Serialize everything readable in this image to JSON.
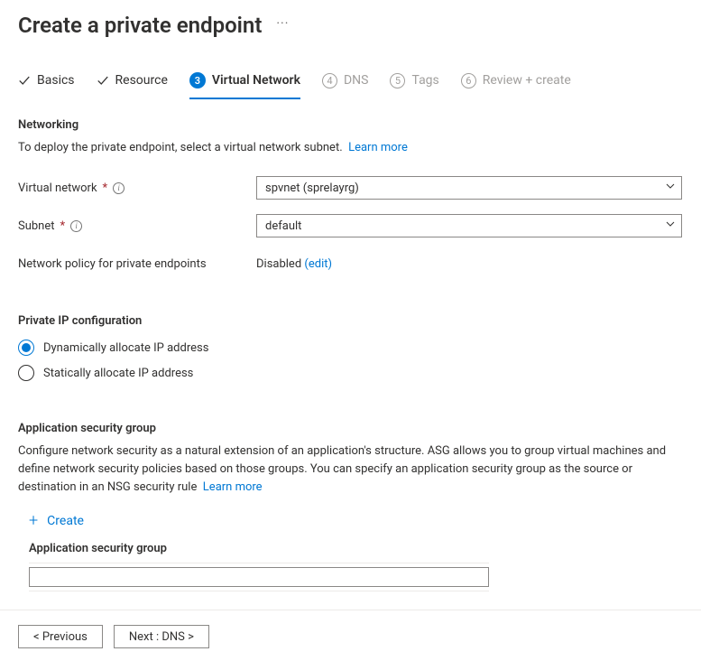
{
  "header": {
    "title": "Create a private endpoint"
  },
  "steps": [
    {
      "label": "Basics",
      "state": "done"
    },
    {
      "label": "Resource",
      "state": "done"
    },
    {
      "label": "Virtual Network",
      "state": "current",
      "num": "3"
    },
    {
      "label": "DNS",
      "state": "future",
      "num": "4"
    },
    {
      "label": "Tags",
      "state": "future",
      "num": "5"
    },
    {
      "label": "Review + create",
      "state": "future",
      "num": "6"
    }
  ],
  "networking": {
    "section_title": "Networking",
    "description": "To deploy the private endpoint, select a virtual network subnet.",
    "learn_more": "Learn more",
    "virtual_network_label": "Virtual network",
    "virtual_network_value": "spvnet (sprelayrg)",
    "subnet_label": "Subnet",
    "subnet_value": "default",
    "policy_label": "Network policy for private endpoints",
    "policy_value": "Disabled",
    "policy_edit": "(edit)"
  },
  "ipconfig": {
    "section_title": "Private IP configuration",
    "options": {
      "dynamic": "Dynamically allocate IP address",
      "static": "Statically allocate IP address"
    }
  },
  "asg": {
    "section_title": "Application security group",
    "description": "Configure network security as a natural extension of an application's structure. ASG allows you to group virtual machines and define network security policies based on those groups. You can specify an application security group as the source or destination in an NSG security rule",
    "learn_more": "Learn more",
    "create_label": "Create",
    "field_label": "Application security group",
    "selected_value": ""
  },
  "footer": {
    "previous": "<  Previous",
    "next": "Next : DNS  >"
  }
}
